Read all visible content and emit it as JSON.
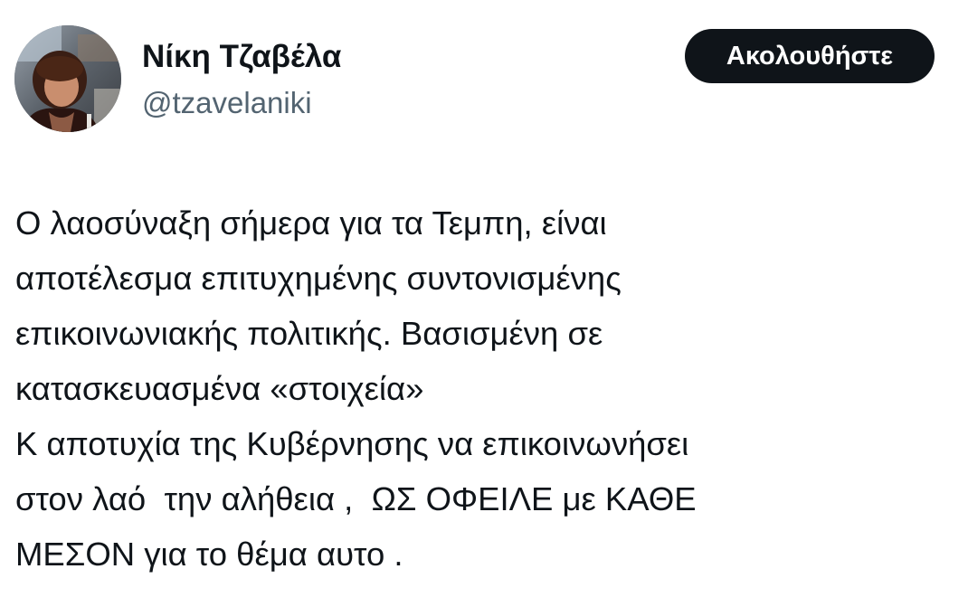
{
  "author": {
    "display_name": "Νίκη Τζαβέλα",
    "handle": "@tzavelaniki",
    "avatar_icon": "profile-photo"
  },
  "follow_button": {
    "label": "Ακολουθήστε",
    "background": "#0f1419",
    "text_color": "#ffffff"
  },
  "tweet": {
    "lines": [
      "Ο λαοσύναξη σήμερα για τα Τεμπη, είναι",
      "αποτέλεσμα επιτυχημένης συντονισμένης",
      "επικοινωνιακής πολιτικής. Βασισμένη σε",
      "κατασκευασμένα «στοιχεία»",
      "Κ αποτυχία της Κυβέρνησης να επικοινωνήσει",
      "στον λαό  την αλήθεια ,  ΩΣ ΟΦΕΙΛΕ με ΚΑΘΕ",
      "ΜΕΣΟΝ για το θέμα αυτο ."
    ]
  },
  "colors": {
    "primary_text": "#0f1419",
    "secondary_text": "#536471",
    "background": "#ffffff"
  }
}
